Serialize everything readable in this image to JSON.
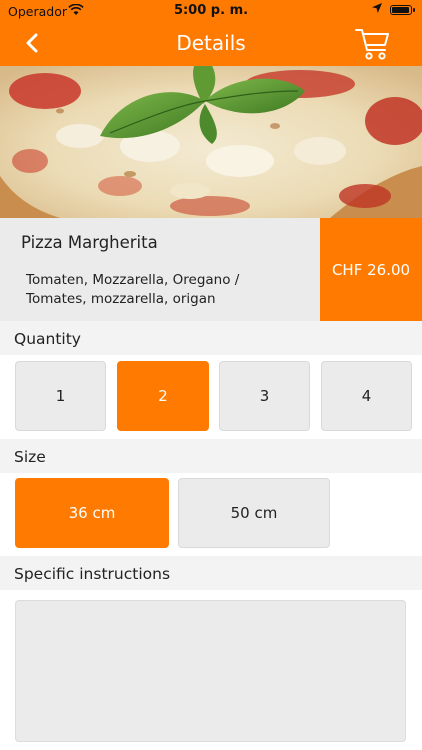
{
  "status_bar": {
    "carrier": "Operador",
    "time": "5:00 p. m."
  },
  "nav": {
    "title": "Details",
    "back_icon": "chevron-left-icon",
    "cart_icon": "cart-icon"
  },
  "product": {
    "name": "Pizza Margherita",
    "description_line1": "Tomaten, Mozzarella, Oregano /",
    "description_line2": "Tomates, mozzarella, origan",
    "price": "CHF 26.00"
  },
  "quantity": {
    "label": "Quantity",
    "options": [
      "1",
      "2",
      "3",
      "4"
    ],
    "selected": "2"
  },
  "size": {
    "label": "Size",
    "options": [
      "36 cm",
      "50 cm"
    ],
    "selected": "36 cm"
  },
  "instructions": {
    "label": "Specific instructions",
    "value": ""
  },
  "colors": {
    "accent": "#ff7a00",
    "option_bg": "#ebebeb",
    "header_bg": "#f3f3f3"
  }
}
